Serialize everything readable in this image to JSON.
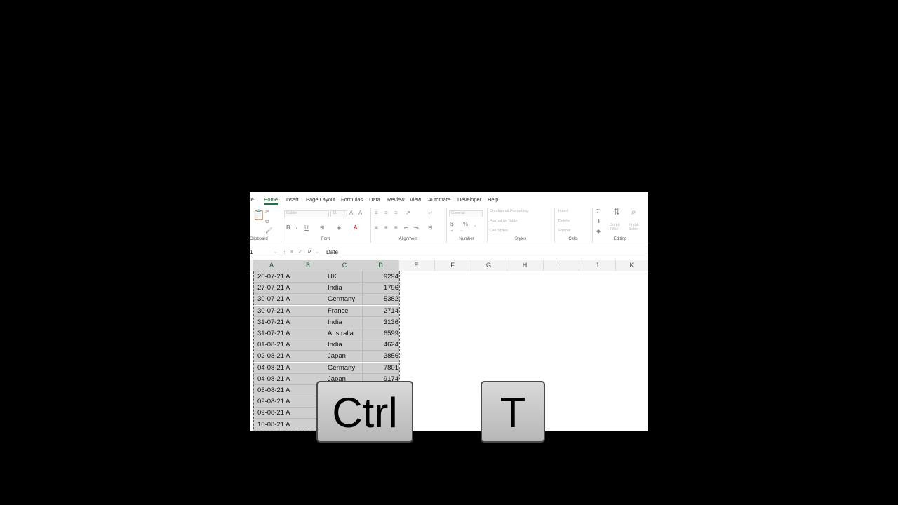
{
  "ribbon_tabs": [
    "le",
    "Home",
    "Insert",
    "Page Layout",
    "Formulas",
    "Data",
    "Review",
    "View",
    "Automate",
    "Developer",
    "Help"
  ],
  "ribbon_groups": {
    "clipboard": "Clipboard",
    "font": "Font",
    "alignment": "Alignment",
    "number": "Number",
    "styles": "Styles",
    "cells": "Cells",
    "editing": "Editing"
  },
  "ribbon_controls": {
    "font_name": "Calibri",
    "font_size": "11",
    "number_format": "General",
    "conditional_formatting": "Conditional Formatting",
    "format_as_table": "Format as Table",
    "cell_styles": "Cell Styles",
    "insert": "Insert",
    "delete": "Delete",
    "format": "Format",
    "sort_filter": "Sort & Filter",
    "find_select": "Find & Select"
  },
  "formula_bar": {
    "name_box": "1",
    "fx": "fx",
    "content": "Date"
  },
  "columns": [
    "A",
    "B",
    "C",
    "D",
    "E",
    "F",
    "G",
    "H",
    "I",
    "J",
    "K"
  ],
  "rows": [
    {
      "a": "26-07-21 A",
      "c": "UK",
      "d": "9294"
    },
    {
      "a": "27-07-21 A",
      "c": "India",
      "d": "1796"
    },
    {
      "a": "30-07-21 A",
      "c": "Germany",
      "d": "5382"
    },
    {
      "a": "30-07-21 A",
      "c": "France",
      "d": "2714"
    },
    {
      "a": "31-07-21 A",
      "c": "India",
      "d": "3136"
    },
    {
      "a": "31-07-21 A",
      "c": "Australia",
      "d": "6599"
    },
    {
      "a": "01-08-21 A",
      "c": "India",
      "d": "4624"
    },
    {
      "a": "02-08-21 A",
      "c": "Japan",
      "d": "3856"
    },
    {
      "a": "04-08-21 A",
      "c": "Germany",
      "d": "7801"
    },
    {
      "a": "04-08-21 A",
      "c": "Japan",
      "d": "9174"
    },
    {
      "a": "05-08-21 A",
      "c": "",
      "d": ""
    },
    {
      "a": "09-08-21 A",
      "c": "",
      "d": ""
    },
    {
      "a": "09-08-21 A",
      "c": "",
      "d": ""
    },
    {
      "a": "10-08-21 A",
      "c": "",
      "d": ""
    }
  ],
  "shortcut": {
    "key1": "Ctrl",
    "plus": "+",
    "key2": "T"
  },
  "colors": {
    "accent": "#217346",
    "selection": "#cfcfcf"
  }
}
